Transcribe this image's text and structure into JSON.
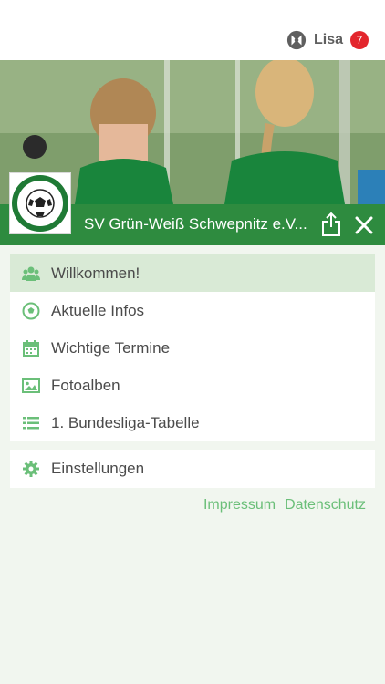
{
  "header": {
    "user_name": "Lisa",
    "notification_count": "7"
  },
  "club": {
    "name": "SV Grün-Weiß Schwepnitz e.V...",
    "logo_text_top": "SV Grün-Weiß",
    "logo_text_bottom": "Schwepnitz"
  },
  "menu": {
    "items": [
      {
        "label": "Willkommen!",
        "icon": "users-icon"
      },
      {
        "label": "Aktuelle Infos",
        "icon": "soccer-ball-icon"
      },
      {
        "label": "Wichtige Termine",
        "icon": "calendar-icon"
      },
      {
        "label": "Fotoalben",
        "icon": "image-icon"
      },
      {
        "label": "1. Bundesliga-Tabelle",
        "icon": "list-icon"
      }
    ],
    "settings_label": "Einstellungen"
  },
  "footer": {
    "impressum": "Impressum",
    "datenschutz": "Datenschutz"
  },
  "colors": {
    "accent_green": "#2e8b3f",
    "active_bg": "#d9ead6",
    "link_green": "#6bbf79",
    "badge_red": "#e3262d"
  }
}
